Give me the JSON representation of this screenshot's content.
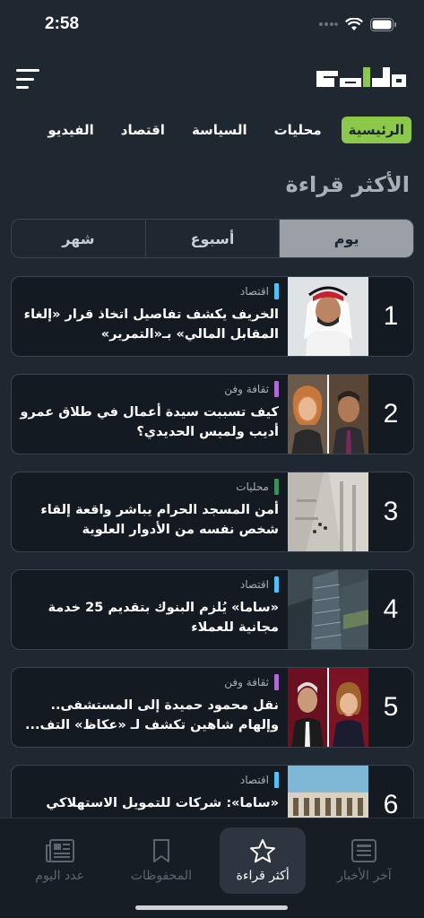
{
  "status_bar": {
    "time": "2:58"
  },
  "header": {
    "logo_alt": "عكاظ"
  },
  "nav": {
    "tabs": [
      {
        "label": "الرئيسية",
        "active": true
      },
      {
        "label": "محليات",
        "active": false
      },
      {
        "label": "السياسة",
        "active": false
      },
      {
        "label": "اقتصاد",
        "active": false
      },
      {
        "label": "الفيديو",
        "active": false
      }
    ]
  },
  "section": {
    "title": "الأكثر قراءة"
  },
  "segments": [
    {
      "label": "يوم",
      "active": true
    },
    {
      "label": "أسبوع",
      "active": false
    },
    {
      "label": "شهر",
      "active": false
    }
  ],
  "articles": [
    {
      "rank": "1",
      "category": "اقتصاد",
      "category_color": "#4fc3f7",
      "title": "الخريف يكشف تفاصيل اتخاذ قرار «إلغاء المقابل المالي» بـ«التمرير»",
      "thumb": "portrait-ghutra"
    },
    {
      "rank": "2",
      "category": "ثقافة وفن",
      "category_color": "#b06ad4",
      "title": "كيف تسببت سيدة أعمال في طلاق عمرو أديب ولميس الحديدي؟",
      "thumb": "two-portraits"
    },
    {
      "rank": "3",
      "category": "محليات",
      "category_color": "#3a8f5a",
      "title": "أمن المسجد الحرام يباشر واقعة إلقاء شخص نفسه من الأدوار العلوية",
      "thumb": "mosque-interior"
    },
    {
      "rank": "4",
      "category": "اقتصاد",
      "category_color": "#4fc3f7",
      "title": "«ساما» يُلزم البنوك بتقديم 25 خدمة مجانية للعملاء",
      "thumb": "city-buildings"
    },
    {
      "rank": "5",
      "category": "ثقافة وفن",
      "category_color": "#b06ad4",
      "title": "نقل محمود حميدة إلى المستشفى.. وإلهام شاهين تكشف لـ «عكاظ» التف...",
      "thumb": "two-portraits-red"
    },
    {
      "rank": "6",
      "category": "اقتصاد",
      "category_color": "#4fc3f7",
      "title": "«ساما»: شركات للتمويل الاستهلاكي",
      "thumb": "building-sky"
    }
  ],
  "bottom_tabs": [
    {
      "label": "آخر الأخبار",
      "icon": "news-icon",
      "active": false
    },
    {
      "label": "أكثر قراءة",
      "icon": "star-icon",
      "active": true
    },
    {
      "label": "المحفوظات",
      "icon": "bookmark-icon",
      "active": false
    },
    {
      "label": "عدد اليوم",
      "icon": "newspaper-icon",
      "active": false
    }
  ]
}
